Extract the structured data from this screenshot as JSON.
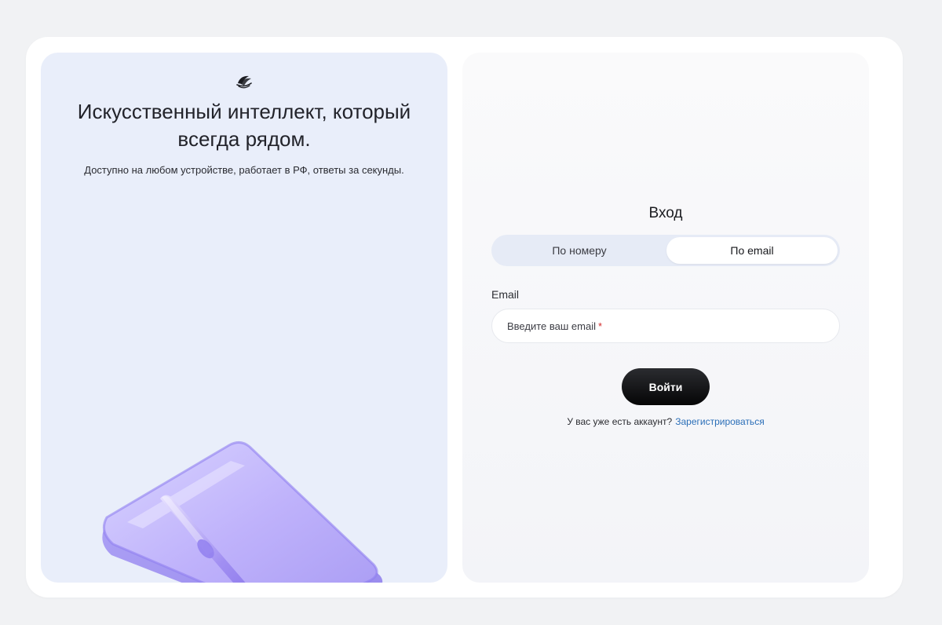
{
  "hero": {
    "title": "Искусственный интеллект, который всегда рядом.",
    "subtitle": "Доступно на любом устройстве, работает в РФ, ответы за секунды."
  },
  "login": {
    "title": "Вход",
    "tabs": [
      {
        "label": "По номеру",
        "active": false
      },
      {
        "label": "По email",
        "active": true
      }
    ],
    "email_label": "Email",
    "email_placeholder": "Введите ваш email",
    "email_required_mark": "*",
    "email_value": "",
    "submit_label": "Войти",
    "register_prompt": "У вас уже есть аккаунт?",
    "register_link": "Зарегистрироваться"
  },
  "icons": {
    "logo": "brand-logo-icon",
    "illustration": "notebook-pen-illustration"
  },
  "colors": {
    "left_panel_bg": "#e9eefa",
    "tab_bg": "#e6ebf6",
    "submit_bg": "#0b0b0c",
    "link": "#2b6fb8",
    "required": "#d22b2b"
  }
}
